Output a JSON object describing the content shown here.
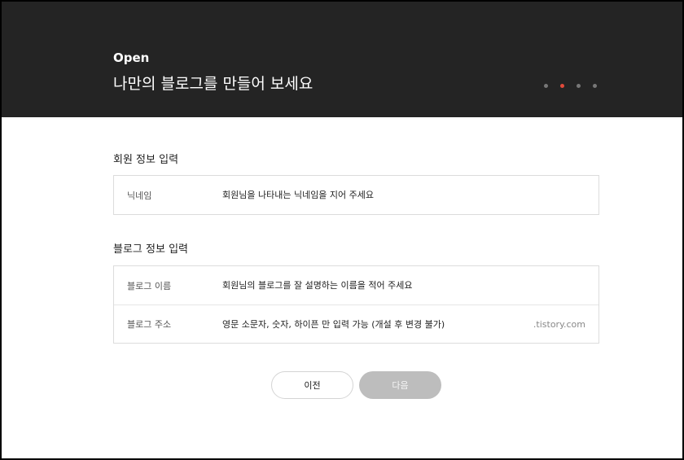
{
  "header": {
    "kicker": "Open",
    "title": "나만의 블로그를 만들어 보세요",
    "steps": {
      "count": 4,
      "active_index": 1
    },
    "colors": {
      "background": "#242424",
      "active_dot": "#e24a3b",
      "inactive_dot": "#777777"
    }
  },
  "member_section": {
    "title": "회원 정보 입력",
    "fields": [
      {
        "label": "닉네임",
        "placeholder": "회원님을 나타내는 닉네임을 지어 주세요"
      }
    ]
  },
  "blog_section": {
    "title": "블로그 정보 입력",
    "fields": [
      {
        "label": "블로그 이름",
        "placeholder": "회원님의 블로그를 잘 설명하는 이름을 적어 주세요"
      },
      {
        "label": "블로그 주소",
        "placeholder": "영문 소문자, 숫자, 하이픈 만 입력 가능 (개설 후 변경 불가)",
        "suffix": ".tistory.com"
      }
    ]
  },
  "buttons": {
    "prev_label": "이전",
    "next_label": "다음",
    "next_color": "#bdbdbd"
  }
}
